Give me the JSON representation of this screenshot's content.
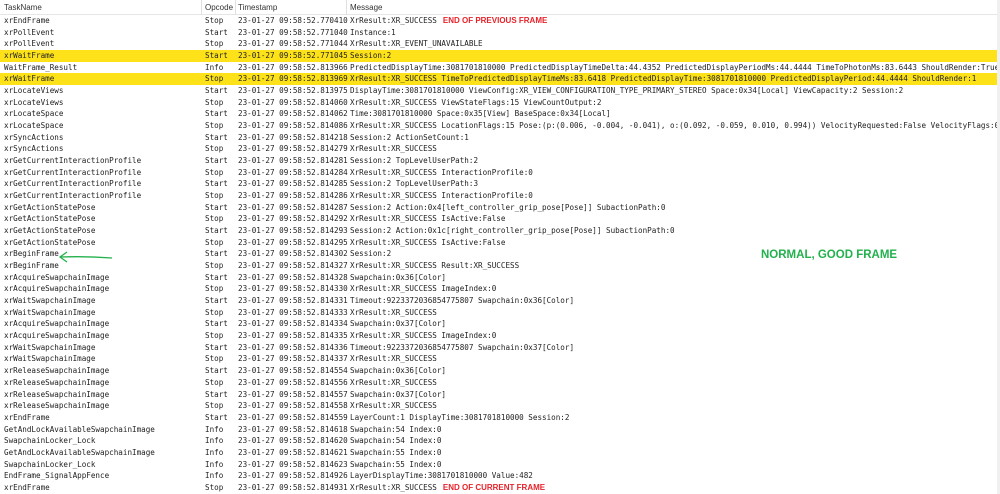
{
  "columns": {
    "task": "TaskName",
    "opcode": "Opcode",
    "timestamp": "Timestamp",
    "message": "Message"
  },
  "annotations": {
    "good_frame": "NORMAL, GOOD FRAME",
    "colors": {
      "highlight": "#fde21a",
      "red": "#e8222a",
      "green": "#22b14c"
    }
  },
  "rows": [
    {
      "task": "xrEndFrame",
      "op": "Stop",
      "ts": "23-01-27 09:58:52.770410",
      "msg": "XrResult:XR_SUCCESS",
      "note": "END OF PREVIOUS FRAME"
    },
    {
      "task": "xrPollEvent",
      "op": "Start",
      "ts": "23-01-27 09:58:52.771040",
      "msg": "Instance:1"
    },
    {
      "task": "xrPollEvent",
      "op": "Stop",
      "ts": "23-01-27 09:58:52.771044",
      "msg": "XrResult:XR_EVENT_UNAVAILABLE"
    },
    {
      "task": "xrWaitFrame",
      "op": "Start",
      "ts": "23-01-27 09:58:52.771045",
      "msg": "Session:2",
      "hl": true
    },
    {
      "task": "WaitFrame_Result",
      "op": "Info",
      "ts": "23-01-27 09:58:52.813966",
      "msg": "PredictedDisplayTime:3081701810000 PredictedDisplayTimeDelta:44.4352 PredictedDisplayPeriodMs:44.4444 TimeToPhotonMs:83.6443 ShouldRender:True"
    },
    {
      "task": "xrWaitFrame",
      "op": "Stop",
      "ts": "23-01-27 09:58:52.813969",
      "msg": "XrResult:XR_SUCCESS TimeToPredictedDisplayTimeMs:83.6418 PredictedDisplayTime:3081701810000 PredictedDisplayPeriod:44.4444 ShouldRender:1",
      "hl": true
    },
    {
      "task": "xrLocateViews",
      "op": "Start",
      "ts": "23-01-27 09:58:52.813975",
      "msg": "DisplayTime:3081701810000 ViewConfig:XR_VIEW_CONFIGURATION_TYPE_PRIMARY_STEREO Space:0x34[Local] ViewCapacity:2 Session:2"
    },
    {
      "task": "xrLocateViews",
      "op": "Stop",
      "ts": "23-01-27 09:58:52.814060",
      "msg": "XrResult:XR_SUCCESS ViewStateFlags:15 ViewCountOutput:2"
    },
    {
      "task": "xrLocateSpace",
      "op": "Start",
      "ts": "23-01-27 09:58:52.814062",
      "msg": "Time:3081701810000 Space:0x35[View] BaseSpace:0x34[Local]"
    },
    {
      "task": "xrLocateSpace",
      "op": "Stop",
      "ts": "23-01-27 09:58:52.814086",
      "msg": "XrResult:XR_SUCCESS LocationFlags:15 Pose:(p:(0.006, -0.004, -0.041), o:(0.092, -0.059, 0.010, 0.994)) VelocityRequested:False VelocityFlags:0"
    },
    {
      "task": "xrSyncActions",
      "op": "Start",
      "ts": "23-01-27 09:58:52.814218",
      "msg": "Session:2 ActionSetCount:1"
    },
    {
      "task": "xrSyncActions",
      "op": "Stop",
      "ts": "23-01-27 09:58:52.814279",
      "msg": "XrResult:XR_SUCCESS"
    },
    {
      "task": "xrGetCurrentInteractionProfile",
      "op": "Start",
      "ts": "23-01-27 09:58:52.814281",
      "msg": "Session:2 TopLevelUserPath:2"
    },
    {
      "task": "xrGetCurrentInteractionProfile",
      "op": "Stop",
      "ts": "23-01-27 09:58:52.814284",
      "msg": "XrResult:XR_SUCCESS InteractionProfile:0"
    },
    {
      "task": "xrGetCurrentInteractionProfile",
      "op": "Start",
      "ts": "23-01-27 09:58:52.814285",
      "msg": "Session:2 TopLevelUserPath:3"
    },
    {
      "task": "xrGetCurrentInteractionProfile",
      "op": "Stop",
      "ts": "23-01-27 09:58:52.814286",
      "msg": "XrResult:XR_SUCCESS InteractionProfile:0"
    },
    {
      "task": "xrGetActionStatePose",
      "op": "Start",
      "ts": "23-01-27 09:58:52.814287",
      "msg": "Session:2 Action:0x4[left_controller_grip_pose[Pose]] SubactionPath:0"
    },
    {
      "task": "xrGetActionStatePose",
      "op": "Stop",
      "ts": "23-01-27 09:58:52.814292",
      "msg": "XrResult:XR_SUCCESS IsActive:False"
    },
    {
      "task": "xrGetActionStatePose",
      "op": "Start",
      "ts": "23-01-27 09:58:52.814293",
      "msg": "Session:2 Action:0x1c[right_controller_grip_pose[Pose]] SubactionPath:0"
    },
    {
      "task": "xrGetActionStatePose",
      "op": "Stop",
      "ts": "23-01-27 09:58:52.814295",
      "msg": "XrResult:XR_SUCCESS IsActive:False"
    },
    {
      "task": "xrBeginFrame",
      "op": "Start",
      "ts": "23-01-27 09:58:52.814302",
      "msg": "Session:2"
    },
    {
      "task": "xrBeginFrame",
      "op": "Stop",
      "ts": "23-01-27 09:58:52.814327",
      "msg": "XrResult:XR_SUCCESS Result:XR_SUCCESS"
    },
    {
      "task": "xrAcquireSwapchainImage",
      "op": "Start",
      "ts": "23-01-27 09:58:52.814328",
      "msg": "Swapchain:0x36[Color]"
    },
    {
      "task": "xrAcquireSwapchainImage",
      "op": "Stop",
      "ts": "23-01-27 09:58:52.814330",
      "msg": "XrResult:XR_SUCCESS ImageIndex:0"
    },
    {
      "task": "xrWaitSwapchainImage",
      "op": "Start",
      "ts": "23-01-27 09:58:52.814331",
      "msg": "Timeout:9223372036854775807 Swapchain:0x36[Color]"
    },
    {
      "task": "xrWaitSwapchainImage",
      "op": "Stop",
      "ts": "23-01-27 09:58:52.814333",
      "msg": "XrResult:XR_SUCCESS"
    },
    {
      "task": "xrAcquireSwapchainImage",
      "op": "Start",
      "ts": "23-01-27 09:58:52.814334",
      "msg": "Swapchain:0x37[Color]"
    },
    {
      "task": "xrAcquireSwapchainImage",
      "op": "Stop",
      "ts": "23-01-27 09:58:52.814335",
      "msg": "XrResult:XR_SUCCESS ImageIndex:0"
    },
    {
      "task": "xrWaitSwapchainImage",
      "op": "Start",
      "ts": "23-01-27 09:58:52.814336",
      "msg": "Timeout:9223372036854775807 Swapchain:0x37[Color]"
    },
    {
      "task": "xrWaitSwapchainImage",
      "op": "Stop",
      "ts": "23-01-27 09:58:52.814337",
      "msg": "XrResult:XR_SUCCESS"
    },
    {
      "task": "xrReleaseSwapchainImage",
      "op": "Start",
      "ts": "23-01-27 09:58:52.814554",
      "msg": "Swapchain:0x36[Color]"
    },
    {
      "task": "xrReleaseSwapchainImage",
      "op": "Stop",
      "ts": "23-01-27 09:58:52.814556",
      "msg": "XrResult:XR_SUCCESS"
    },
    {
      "task": "xrReleaseSwapchainImage",
      "op": "Start",
      "ts": "23-01-27 09:58:52.814557",
      "msg": "Swapchain:0x37[Color]"
    },
    {
      "task": "xrReleaseSwapchainImage",
      "op": "Stop",
      "ts": "23-01-27 09:58:52.814558",
      "msg": "XrResult:XR_SUCCESS"
    },
    {
      "task": "xrEndFrame",
      "op": "Start",
      "ts": "23-01-27 09:58:52.814559",
      "msg": "LayerCount:1 DisplayTime:3081701810000 Session:2"
    },
    {
      "task": "GetAndLockAvailableSwapchainImage",
      "op": "Info",
      "ts": "23-01-27 09:58:52.814618",
      "msg": "Swapchain:54 Index:0"
    },
    {
      "task": "SwapchainLocker_Lock",
      "op": "Info",
      "ts": "23-01-27 09:58:52.814620",
      "msg": "Swapchain:54 Index:0"
    },
    {
      "task": "GetAndLockAvailableSwapchainImage",
      "op": "Info",
      "ts": "23-01-27 09:58:52.814621",
      "msg": "Swapchain:55 Index:0"
    },
    {
      "task": "SwapchainLocker_Lock",
      "op": "Info",
      "ts": "23-01-27 09:58:52.814623",
      "msg": "Swapchain:55 Index:0"
    },
    {
      "task": "EndFrame_SignalAppFence",
      "op": "Info",
      "ts": "23-01-27 09:58:52.814926",
      "msg": "LayerDisplayTime:3081701810000 Value:482"
    },
    {
      "task": "xrEndFrame",
      "op": "Stop",
      "ts": "23-01-27 09:58:52.814931",
      "msg": "XrResult:XR_SUCCESS",
      "note": "END OF CURRENT FRAME"
    }
  ]
}
